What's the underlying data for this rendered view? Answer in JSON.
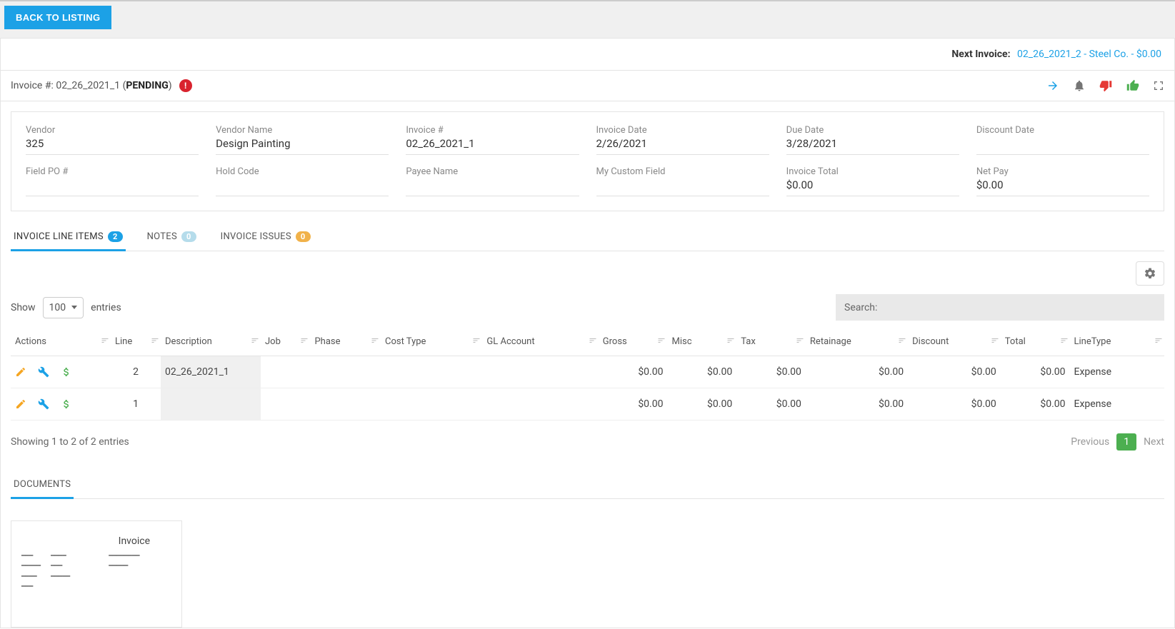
{
  "back_button": "BACK TO LISTING",
  "next_invoice": {
    "label": "Next Invoice:",
    "link_text": "02_26_2021_2 - Steel Co. - $0.00"
  },
  "invoice_header": {
    "prefix": "Invoice #: ",
    "number": "02_26_2021_1",
    "status": "PENDING",
    "alert": "!"
  },
  "fields_row1": [
    {
      "label": "Vendor",
      "value": "325"
    },
    {
      "label": "Vendor Name",
      "value": "Design Painting"
    },
    {
      "label": "Invoice #",
      "value": "02_26_2021_1"
    },
    {
      "label": "Invoice Date",
      "value": "2/26/2021"
    },
    {
      "label": "Due Date",
      "value": "3/28/2021"
    },
    {
      "label": "Discount Date",
      "value": ""
    }
  ],
  "fields_row2": [
    {
      "label": "Field PO #",
      "value": ""
    },
    {
      "label": "Hold Code",
      "value": ""
    },
    {
      "label": "Payee Name",
      "value": ""
    },
    {
      "label": "My Custom Field",
      "value": ""
    },
    {
      "label": "Invoice Total",
      "value": "$0.00"
    },
    {
      "label": "Net Pay",
      "value": "$0.00"
    }
  ],
  "tabs": [
    {
      "label": "INVOICE LINE ITEMS",
      "badge": "2",
      "badge_class": "blue",
      "active": true
    },
    {
      "label": "NOTES",
      "badge": "0",
      "badge_class": "lightblue",
      "active": false
    },
    {
      "label": "INVOICE ISSUES",
      "badge": "0",
      "badge_class": "orange",
      "active": false
    }
  ],
  "show": {
    "label_before": "Show",
    "value": "100",
    "label_after": "entries"
  },
  "search": {
    "label": "Search:",
    "value": ""
  },
  "columns": [
    "Actions",
    "Line",
    "Description",
    "Job",
    "Phase",
    "Cost Type",
    "GL Account",
    "Gross",
    "Misc",
    "Tax",
    "Retainage",
    "Discount",
    "Total",
    "LineType"
  ],
  "rows": [
    {
      "line": "2",
      "description": "02_26_2021_1",
      "job": "",
      "phase": "",
      "cost_type": "",
      "gl": "",
      "gross": "$0.00",
      "misc": "$0.00",
      "tax": "$0.00",
      "retainage": "$0.00",
      "discount": "$0.00",
      "total": "$0.00",
      "linetype": "Expense"
    },
    {
      "line": "1",
      "description": "",
      "job": "",
      "phase": "",
      "cost_type": "",
      "gl": "",
      "gross": "$0.00",
      "misc": "$0.00",
      "tax": "$0.00",
      "retainage": "$0.00",
      "discount": "$0.00",
      "total": "$0.00",
      "linetype": "Expense"
    }
  ],
  "footer": {
    "info": "Showing 1 to 2 of 2 entries",
    "prev": "Previous",
    "pages": [
      "1"
    ],
    "next": "Next"
  },
  "documents_tab": "DOCUMENTS",
  "doc_preview_title": "Invoice"
}
